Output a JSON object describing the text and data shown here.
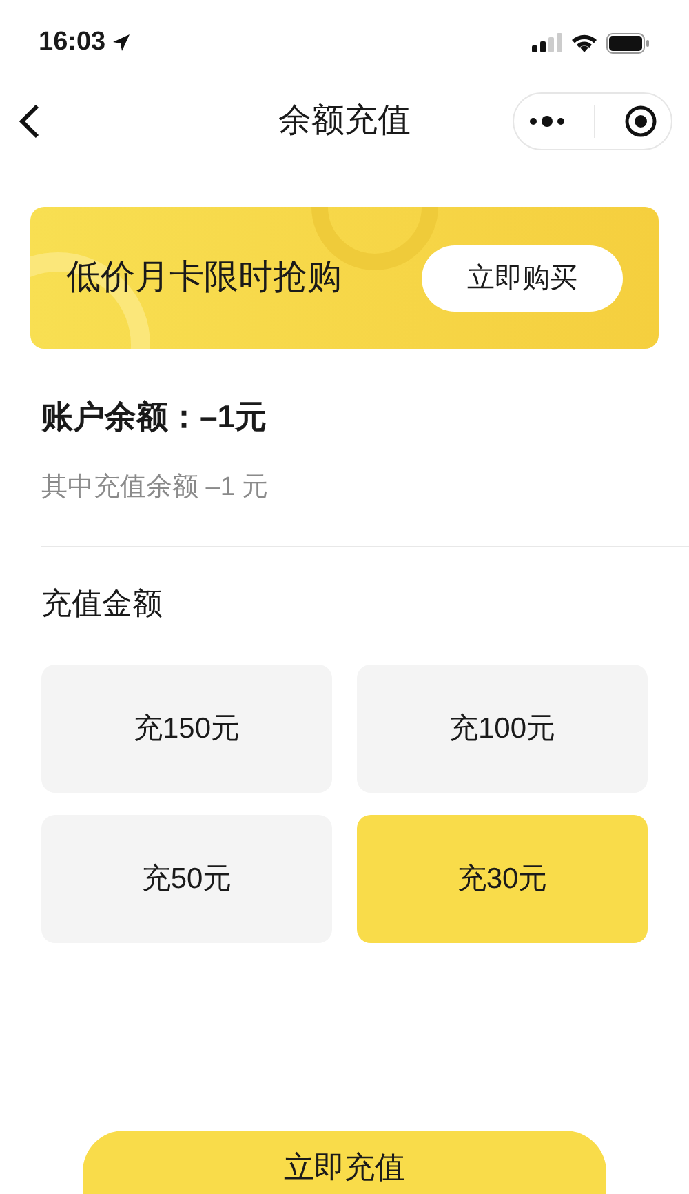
{
  "status_bar": {
    "time": "16:03"
  },
  "nav": {
    "title": "余额充值"
  },
  "banner": {
    "text": "低价月卡限时抢购",
    "button": "立即购买"
  },
  "balance": {
    "label": "账户余额：–1元",
    "detail": "其中充值余额 –1 元"
  },
  "amounts": {
    "label": "充值金额",
    "options": [
      {
        "label": "充150元",
        "selected": false
      },
      {
        "label": "充100元",
        "selected": false
      },
      {
        "label": "充50元",
        "selected": false
      },
      {
        "label": "充30元",
        "selected": true
      }
    ]
  },
  "submit": "立即充值"
}
